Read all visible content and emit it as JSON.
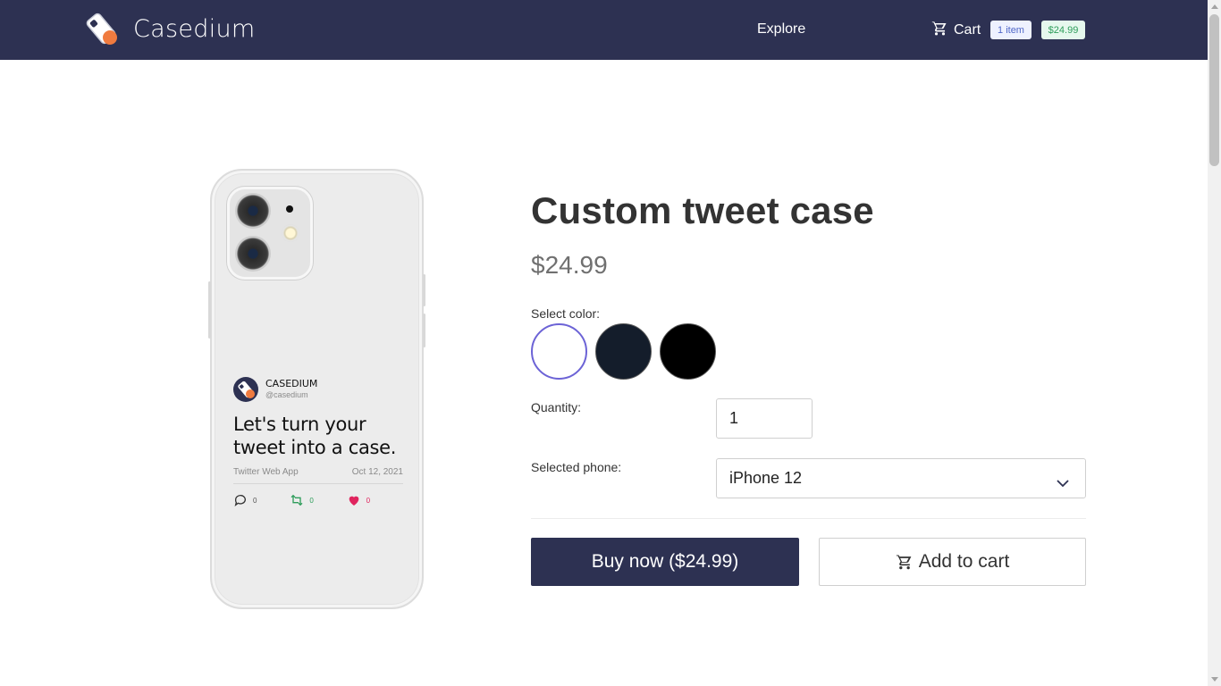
{
  "header": {
    "brand": "Casedium",
    "nav_explore": "Explore",
    "cart_label": "Cart",
    "cart_count": "1 item",
    "cart_total": "$24.99",
    "bg_color": "#2d3152"
  },
  "phone_preview": {
    "tweet_name": "CASEDIUM",
    "tweet_handle": "@casedium",
    "tweet_text": "Let's turn your tweet into a case.",
    "tweet_source": "Twitter Web App",
    "tweet_date": "Oct 12, 2021",
    "replies": "0",
    "retweets": "0",
    "likes": "0"
  },
  "product": {
    "title": "Custom tweet case",
    "price": "$24.99",
    "color_label": "Select color:",
    "colors": [
      {
        "name": "white",
        "hex": "#ffffff",
        "selected": true
      },
      {
        "name": "navy",
        "hex": "#141d2b",
        "selected": false
      },
      {
        "name": "black",
        "hex": "#000000",
        "selected": false
      }
    ],
    "quantity_label": "Quantity:",
    "quantity_value": "1",
    "phone_label": "Selected phone:",
    "phone_value": "iPhone 12",
    "buy_label": "Buy now ($24.99)",
    "add_label": "Add to cart"
  },
  "icons": {
    "logo": "phone-case-logo-icon",
    "cart": "cart-icon",
    "chevron": "chevron-down-icon",
    "reply": "comment-icon",
    "retweet": "retweet-icon",
    "like": "heart-icon"
  },
  "accent_colors": {
    "selected_swatch_border": "#6c63d6",
    "retweet": "#2f9d5b",
    "like": "#e0245e"
  }
}
